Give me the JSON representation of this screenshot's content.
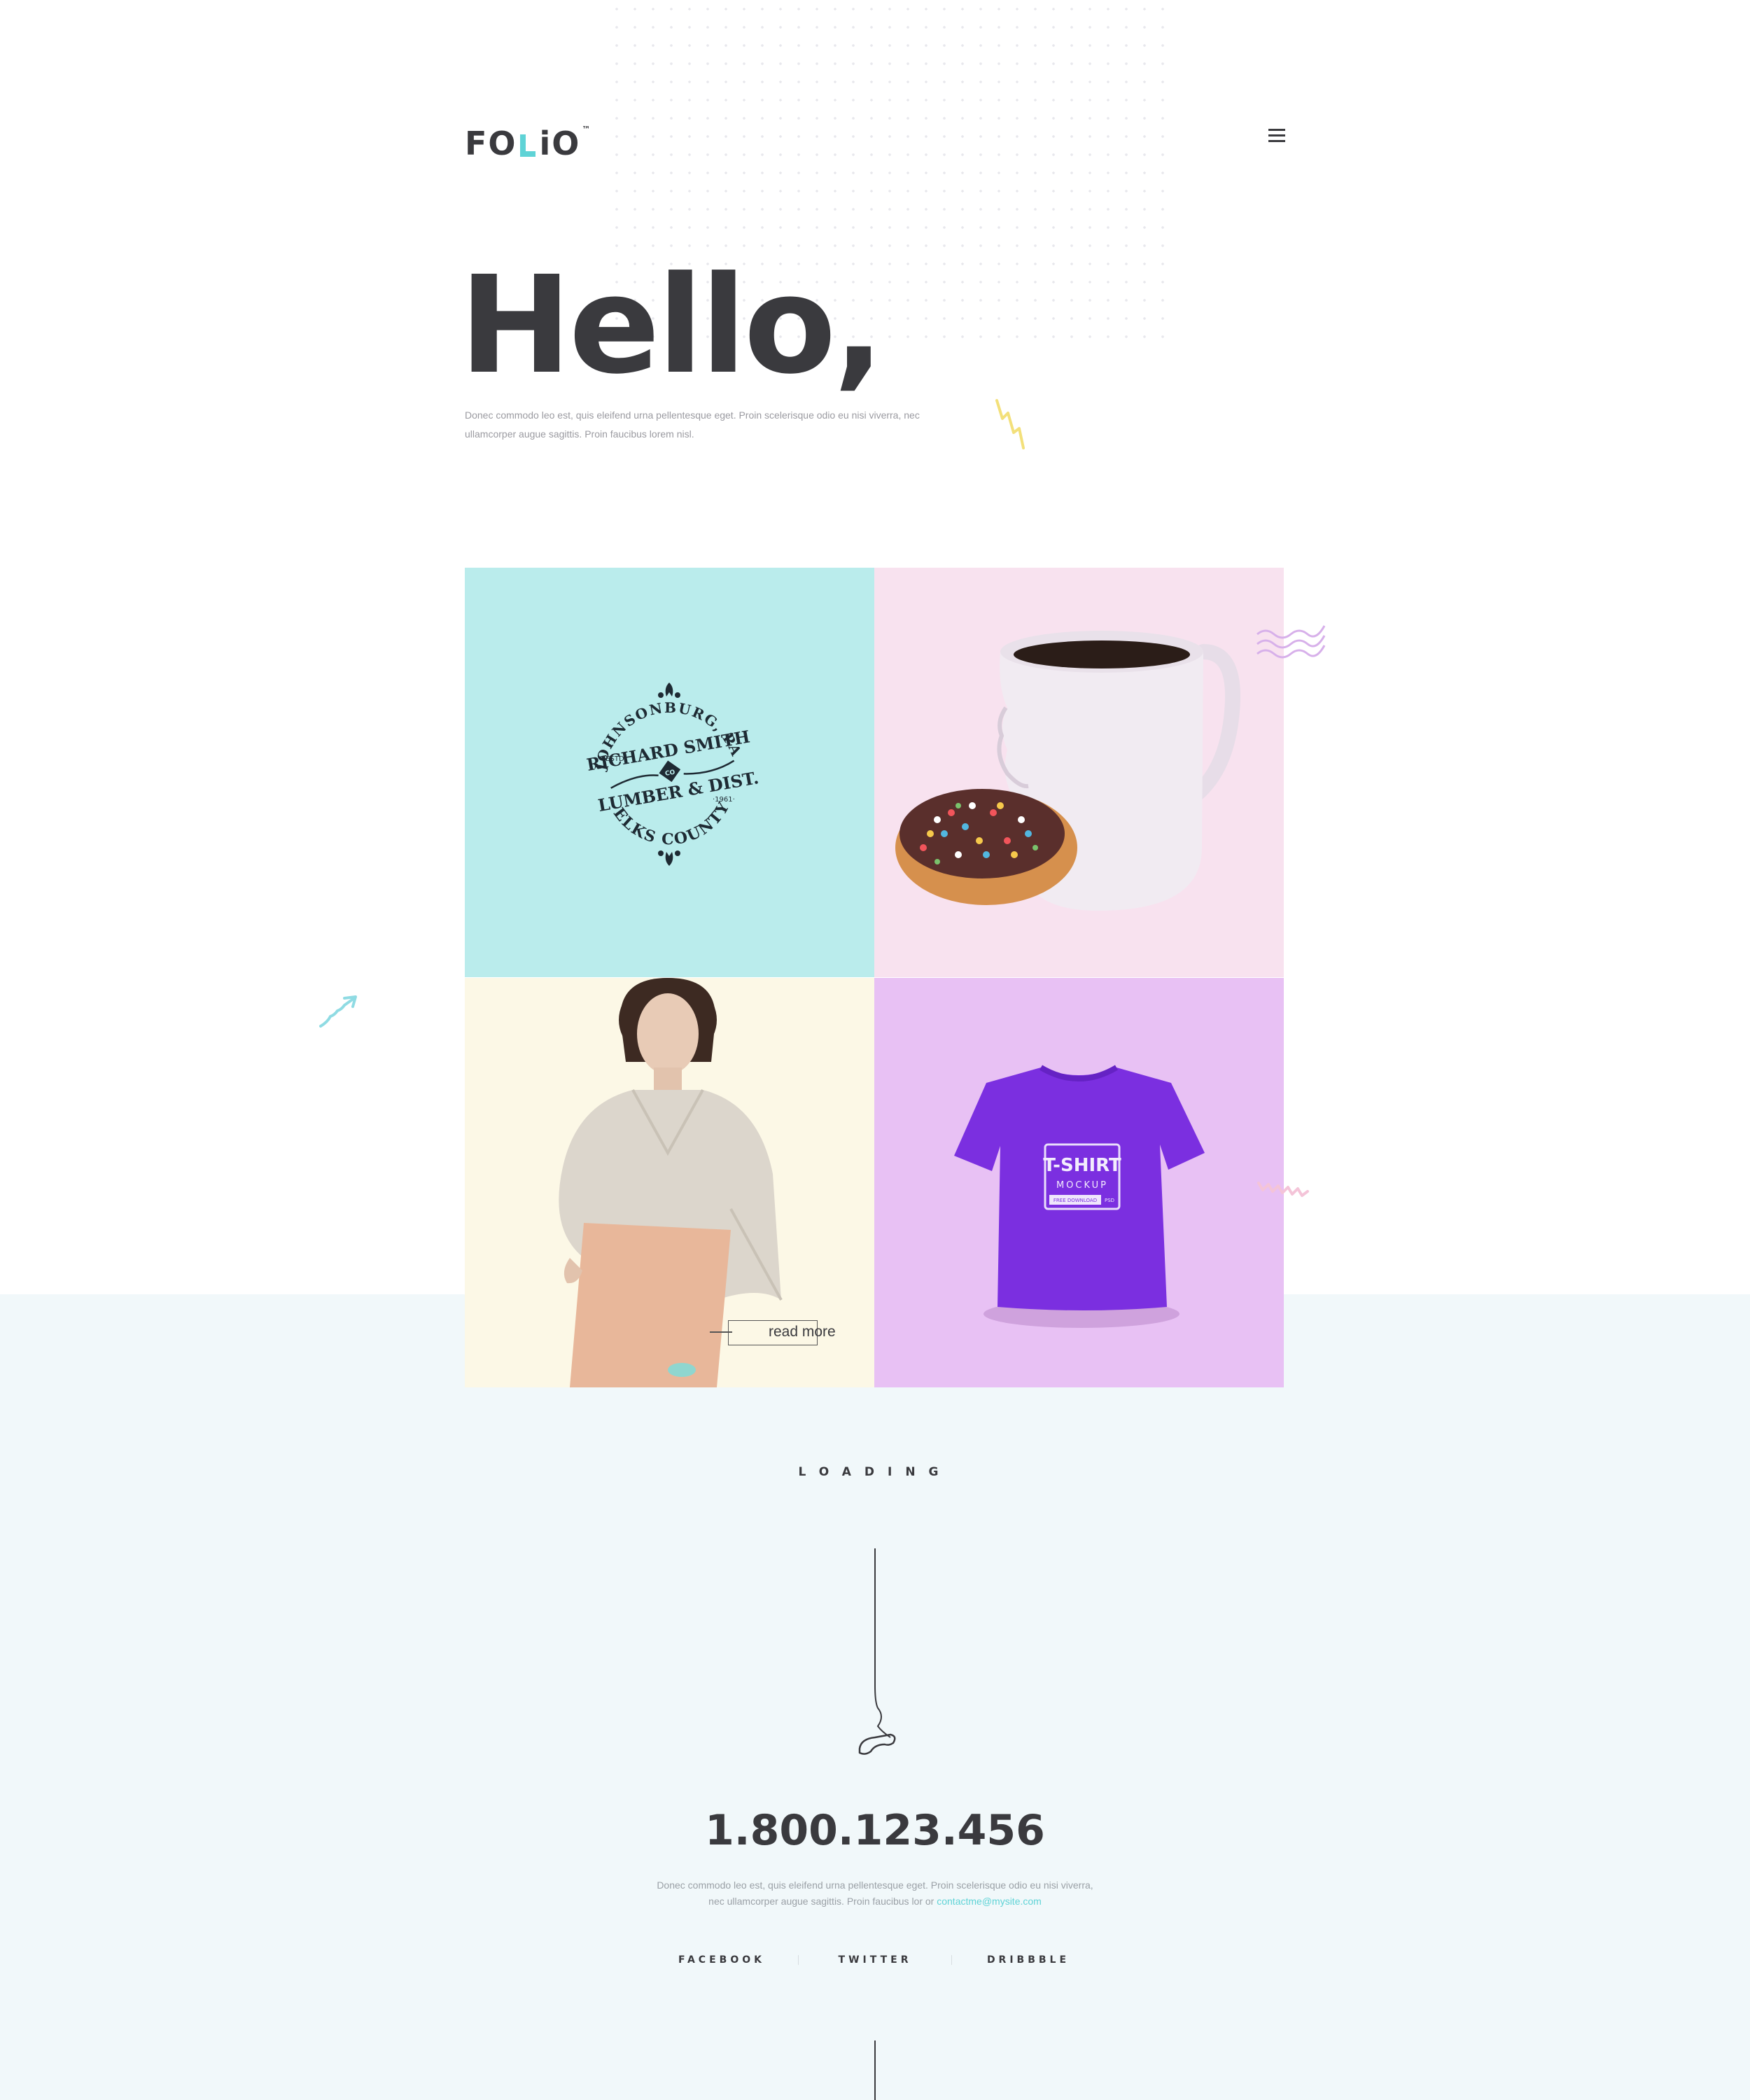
{
  "header": {
    "logo_left": "FO",
    "logo_right": "iO",
    "logo_tm": "™"
  },
  "hero": {
    "title": "Hello,",
    "text": "Donec commodo leo est, quis eleifend urna pellentesque eget. Proin scelerisque odio eu nisi viverra, nec ullamcorper augue sagittis. Proin faucibus lorem nisl."
  },
  "portfolio": {
    "badge": {
      "top_arc": "JOHNSONBURG, PA",
      "line1": "RICHARD SMITH",
      "co": "CO",
      "line2": "LUMBER & DIST.",
      "estd": "·ESTD·",
      "year": "·1961·",
      "bottom_arc": "ELKS COUNTY"
    },
    "tshirt": {
      "title": "T-SHIRT",
      "subtitle": "MOCKUP",
      "tag": "FREE DOWNLOAD",
      "format": "PSD"
    },
    "read_more": "read more"
  },
  "loading": "LOADING",
  "contact": {
    "phone": "1.800.123.456",
    "text_line1": "Donec commodo leo est, quis eleifend urna pellentesque eget. Proin scelerisque odio eu nisi viverra,",
    "text_line2": "nec ullamcorper augue sagittis. Proin faucibus lor or",
    "email": "contactme@mysite.com"
  },
  "social": [
    "FACEBOOK",
    "TWITTER",
    "DRIBBBLE"
  ],
  "colors": {
    "dark": "#3a3a3e",
    "accent": "#5fd3d6",
    "tile_teal": "#baecec",
    "tile_pink": "#f8e2ef",
    "tile_cream": "#fcf8e6",
    "tile_lilac": "#e8c1f4",
    "band": "#f1f8fa"
  }
}
